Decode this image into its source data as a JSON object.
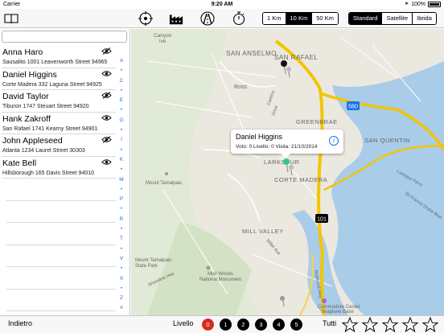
{
  "status": {
    "carrier": "Carrier",
    "time": "9:20 AM",
    "battery": "100%"
  },
  "toolbar": {
    "icons": [
      "book-icon",
      "crosshair-icon",
      "factory-icon",
      "road-icon",
      "stopwatch-icon"
    ],
    "distance": {
      "options": [
        "1 Km",
        "10 Km",
        "50 Km"
      ],
      "selected": 1
    },
    "maptype": {
      "options": [
        "Standard",
        "Satellite",
        "Ibrida"
      ],
      "selected": 0
    }
  },
  "search": {
    "placeholder": ""
  },
  "contacts": [
    {
      "name": "Anna Haro",
      "address": "Sausalito 1001  Leavenworth Street 94965",
      "visible": false
    },
    {
      "name": "Daniel Higgins",
      "address": "Corte Madera 332 Laguna Street 94925",
      "visible": true
    },
    {
      "name": "David Taylor",
      "address": "Tiburon 1747 Steuart Street 94920",
      "visible": false
    },
    {
      "name": "Hank Zakroff",
      "address": "San Rafael 1741 Kearny Street 94901",
      "visible": true
    },
    {
      "name": "John Appleseed",
      "address": "Atlanta 1234 Laurel Street 30303",
      "visible": false
    },
    {
      "name": "Kate Bell",
      "address": "Hillsborough 165 Davis Street 94010",
      "visible": true
    }
  ],
  "index_letters": [
    "A",
    "•",
    "C",
    "•",
    "E",
    "•",
    "G",
    "•",
    "I",
    "•",
    "K",
    "•",
    "M",
    "•",
    "P",
    "•",
    "R",
    "•",
    "T",
    "•",
    "V",
    "•",
    "X",
    "•",
    "Z",
    "#"
  ],
  "map": {
    "places": [
      {
        "label": "Canyon",
        "sub": "ive"
      },
      {
        "label": "SAN ANSELMO"
      },
      {
        "label": "SAN RAFAEL"
      },
      {
        "label": "Ross"
      },
      {
        "label": "GREENBRAE"
      },
      {
        "label": "SAN QUENTIN"
      },
      {
        "label": "LARKSPUR"
      },
      {
        "label": "CORTE MADERA"
      },
      {
        "label": "Mount Tamalpais"
      },
      {
        "label": "MILL VALLEY"
      },
      {
        "label": "Mount Tamalpais",
        "sub": "State Park"
      },
      {
        "label": "Muir Woods",
        "sub": "National Monument"
      },
      {
        "label": "Commodore Center",
        "sub": "Seaplane Base"
      },
      {
        "label": "Larkspur Ferry"
      },
      {
        "label": "Camino",
        "sub": "Drive"
      },
      {
        "label": "Miller Ave"
      },
      {
        "label": "Shoreline Hwy"
      },
      {
        "label": "Sir Francis Drake Blvd"
      },
      {
        "label": "Redwood Hwy"
      }
    ],
    "highways": [
      "101",
      "580"
    ],
    "callout": {
      "title": "Daniel Higgins",
      "subtitle": "Voto: 0 Livello: 0 Visita: 21/10/2014",
      "info_glyph": "i"
    }
  },
  "bottom": {
    "back_label": "Indietro",
    "livello_label": "Livello",
    "levels": [
      "0",
      "1",
      "2",
      "3",
      "4",
      "5"
    ],
    "selected_level": 0,
    "tutti_label": "Tutti",
    "rating": {
      "stars": 5,
      "value": 0
    }
  },
  "colors": {
    "accent": "#1a73e8",
    "highway": "#f2c500",
    "water": "#a9cce8",
    "selected_level": "#d62b1e",
    "pin_green": "#33c48b"
  }
}
